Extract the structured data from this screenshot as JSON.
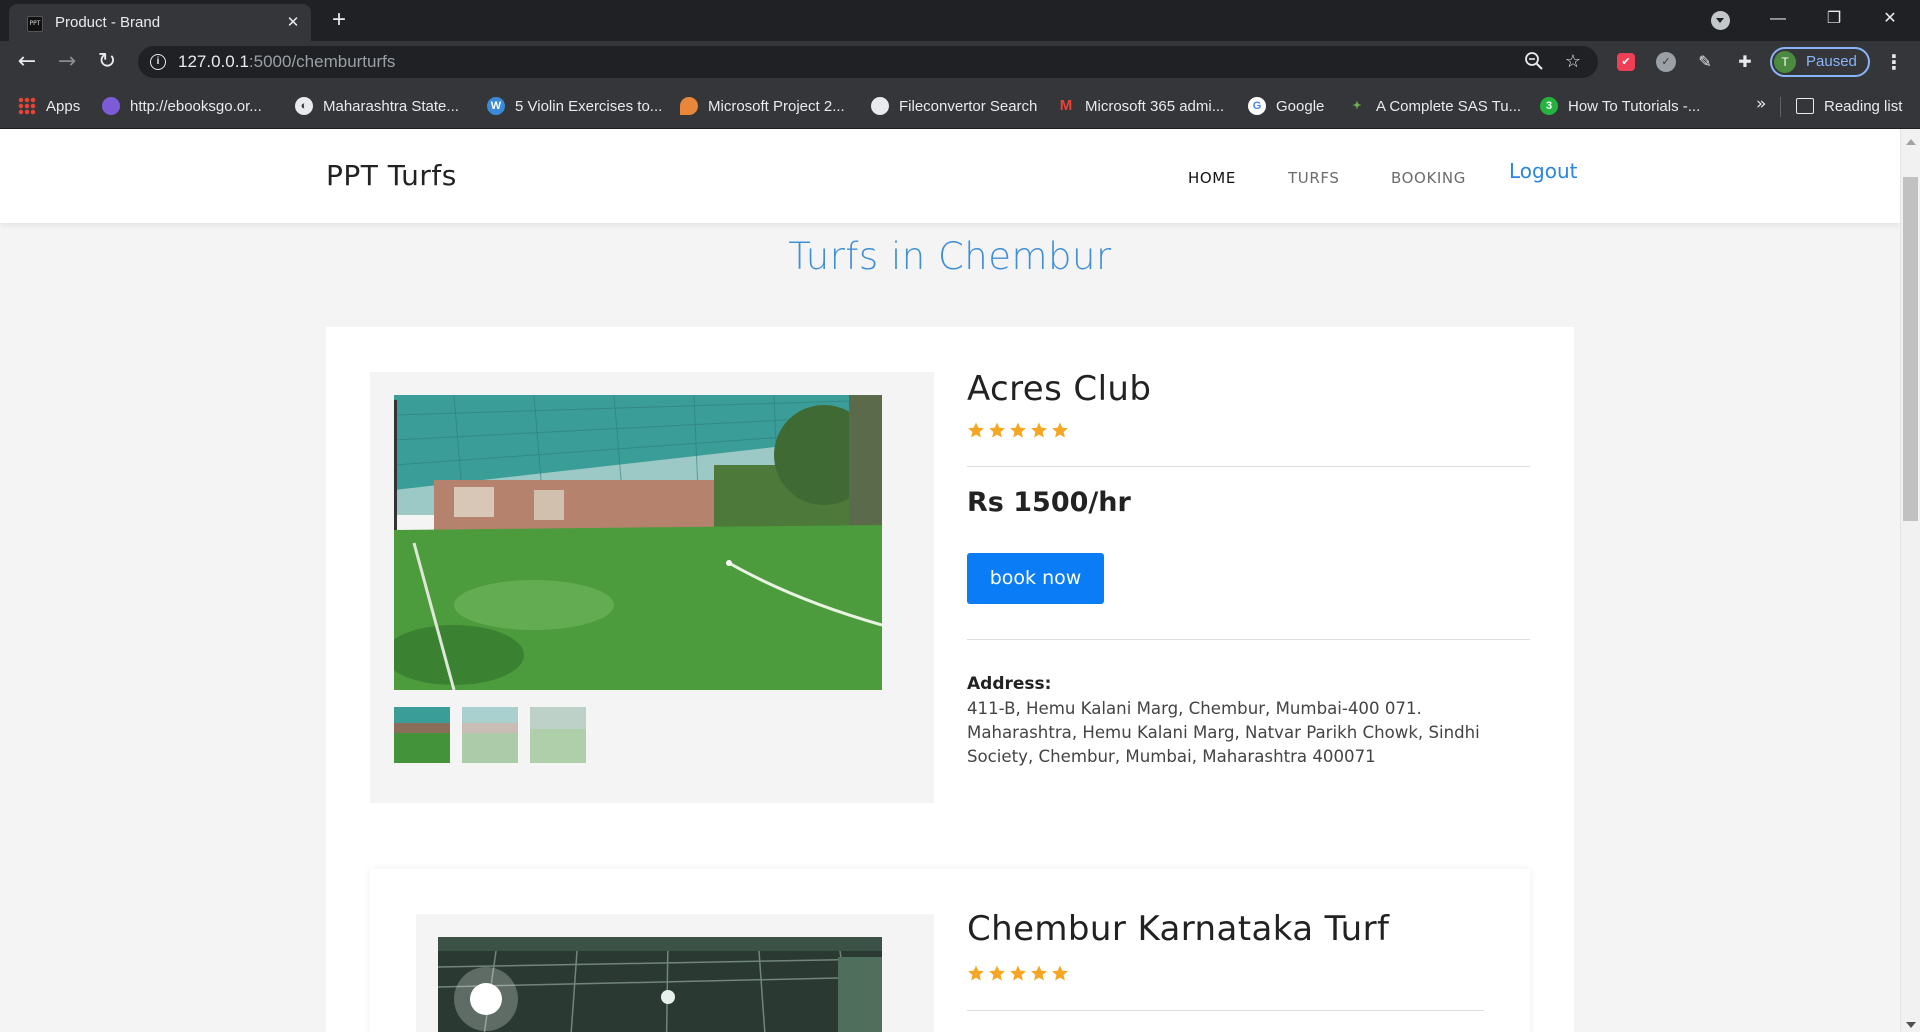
{
  "browser": {
    "tab_title": "Product - Brand",
    "tab_close": "✕",
    "new_tab": "+",
    "url_host": "127.0.0.1",
    "url_path": ":5000/chemburturfs",
    "profile_initial": "T",
    "profile_status": "Paused",
    "window_minimize": "—",
    "window_restore": "❐",
    "window_close": "✕"
  },
  "bookmarks": {
    "items": [
      {
        "label": "Apps",
        "icon": "apps-grid-icon"
      },
      {
        "label": "http://ebooksgo.or...",
        "icon": "ebooksgo-icon"
      },
      {
        "label": "Maharashtra State...",
        "icon": "globe-icon"
      },
      {
        "label": "5 Violin Exercises to...",
        "icon": "wordpress-icon"
      },
      {
        "label": "Microsoft Project 2...",
        "icon": "location-pin-icon"
      },
      {
        "label": "Fileconvertor Search",
        "icon": "github-icon"
      },
      {
        "label": "Microsoft 365 admi...",
        "icon": "gmail-icon"
      },
      {
        "label": "Google",
        "icon": "google-icon"
      },
      {
        "label": "A Complete SAS Tu...",
        "icon": "sas-icon"
      },
      {
        "label": "How To Tutorials -...",
        "icon": "whatsapp-icon"
      }
    ],
    "more": "»",
    "reading_list": "Reading list"
  },
  "site": {
    "brand": "PPT Turfs",
    "nav": {
      "home": "HOME",
      "turfs": "TURFS",
      "booking": "BOOKING",
      "logout": "Logout"
    },
    "heading": "Turfs in Chembur"
  },
  "turfs": [
    {
      "name": "Acres Club",
      "rating": 5,
      "price": "Rs 1500/hr",
      "book_label": "book now",
      "address_label": "Address:",
      "address": "411-B, Hemu Kalani Marg, Chembur, Mumbai-400 071. Maharashtra, Hemu Kalani Marg, Natvar Parikh Chowk, Sindhi Society, Chembur, Mumbai, Maharashtra 400071"
    },
    {
      "name": "Chembur Karnataka Turf",
      "rating": 5
    }
  ],
  "colors": {
    "accent": "#3f8fd6",
    "button": "#0a7cf5",
    "star": "#f5a623"
  }
}
